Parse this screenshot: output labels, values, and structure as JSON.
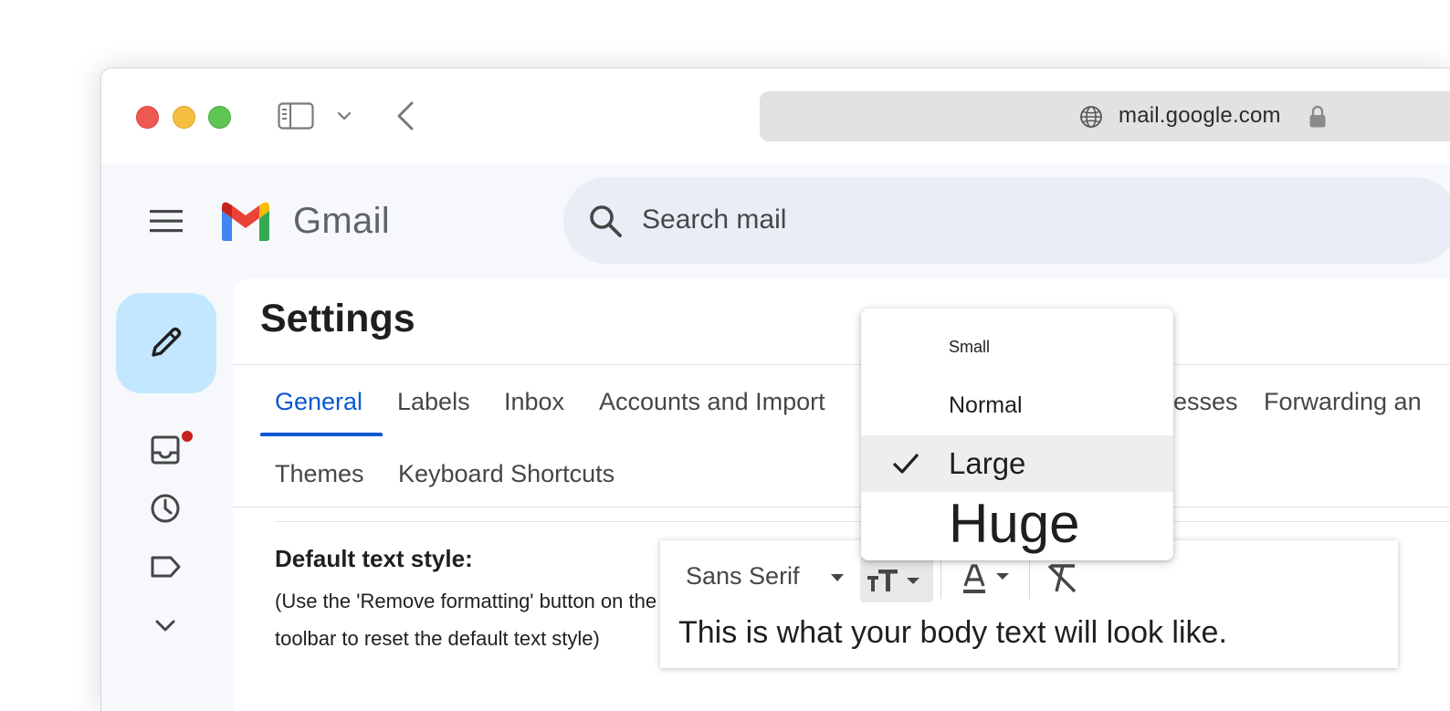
{
  "browser": {
    "url": "mail.google.com"
  },
  "gmail": {
    "brand": "Gmail",
    "search_placeholder": "Search mail"
  },
  "settings": {
    "title": "Settings",
    "tabs_row1": [
      "General",
      "Labels",
      "Inbox",
      "Accounts and Import",
      "esses",
      "Forwarding an"
    ],
    "tabs_row2": [
      "Themes",
      "Keyboard Shortcuts"
    ],
    "active_tab": "General",
    "default_text_style": {
      "label": "Default text style:",
      "help": "(Use the 'Remove formatting' button on the toolbar to reset the default text style)"
    },
    "editor": {
      "font": "Sans Serif",
      "preview": "This is what your body text will look like."
    },
    "size_menu": {
      "options": [
        "Small",
        "Normal",
        "Large",
        "Huge"
      ],
      "selected": "Large"
    }
  },
  "colors": {
    "accent": "#0b57d0",
    "compose_bg": "#c2e7ff",
    "search_bg": "#e9eef6",
    "badge": "#c5221f"
  },
  "icons": {
    "menu": "menu-icon",
    "search": "search-icon",
    "compose": "pencil-icon",
    "inbox": "inbox-icon",
    "snoozed": "clock-icon",
    "labels": "label-icon",
    "more": "chevron-down-icon"
  }
}
